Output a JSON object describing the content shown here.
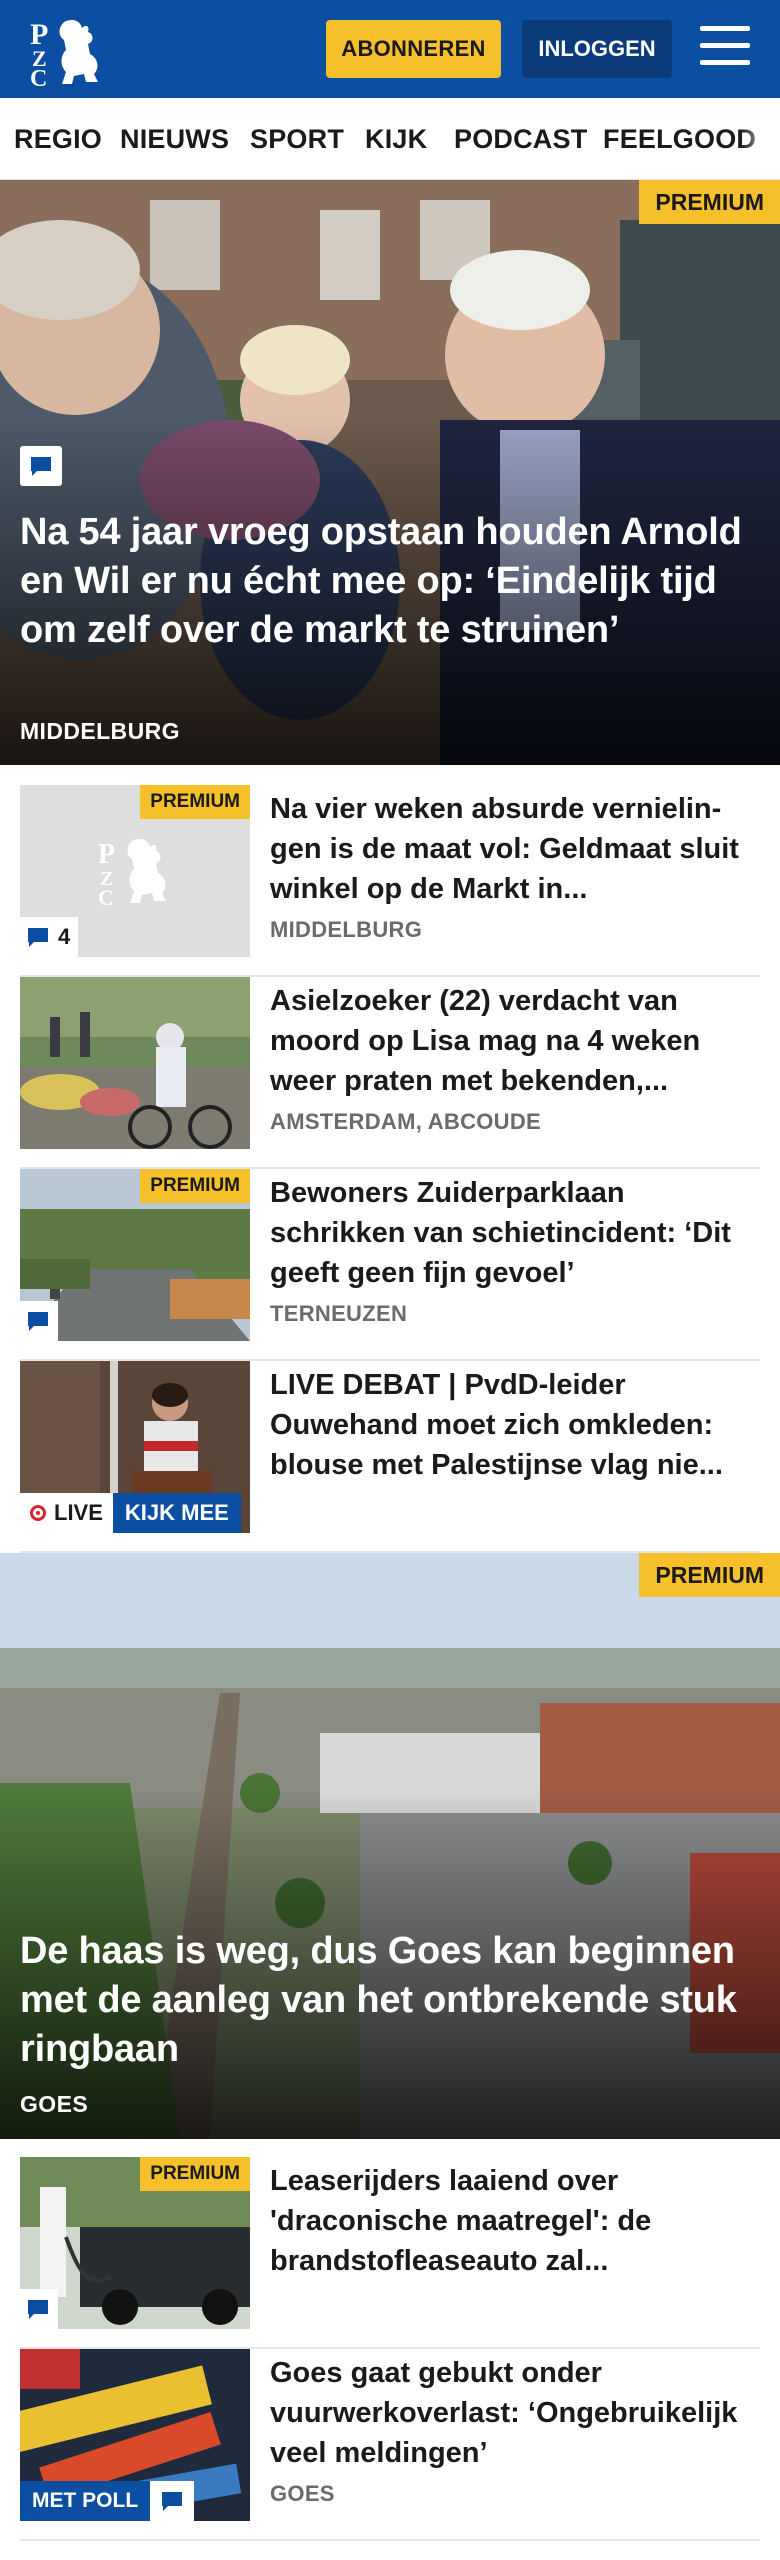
{
  "header": {
    "logo_text": "PZC",
    "subscribe_label": "ABONNEREN",
    "login_label": "INLOGGEN"
  },
  "nav": {
    "items": [
      "REGIO",
      "NIEUWS",
      "SPORT",
      "KIJK",
      "PODCAST",
      "FEELGOOD"
    ]
  },
  "colors": {
    "brand_blue": "#0b4ea2",
    "premium_yellow": "#f5c02a",
    "live_red": "#d9232e"
  },
  "hero1": {
    "badge": "PREMIUM",
    "title": "Na 54 jaar vroeg opstaan houden Arnold en Wil er nu écht mee op: ‘Eindelijk tijd om zelf over de markt te struinen’",
    "location": "MIDDELBURG",
    "icon": "comment-icon"
  },
  "articles": [
    {
      "badge": "PREMIUM",
      "title": "Na vier weken absurde vernielin­gen is de maat vol: Geldmaat sluit winkel op de Markt in...",
      "location": "MIDDELBURG",
      "comment_count": "4"
    },
    {
      "title": "Asielzoeker (22) verdacht van moord op Lisa mag na 4 weken weer praten met bekenden,...",
      "location": "AMSTERDAM, ABCOUDE"
    },
    {
      "badge": "PREMIUM",
      "title": "Bewoners Zuiderparklaan schrikken van schietincident: ‘Dit geeft geen fijn gevoel’",
      "location": "TERNEUZEN"
    },
    {
      "title": "LIVE DEBAT | PvdD-leider Ouwehand moet zich omkleden: blouse met Palestijnse vlag nie...",
      "live_label": "LIVE",
      "watch_label": "KIJK MEE"
    }
  ],
  "hero2": {
    "badge": "PREMIUM",
    "title": "De haas is weg, dus Goes kan beginnen met de aanleg van het ontbrekende stuk ringbaan",
    "location": "GOES"
  },
  "articles2": [
    {
      "badge": "PREMIUM",
      "title": "Leaserijders laaiend over 'draconische maatregel': de brandstofleaseauto zal..."
    },
    {
      "title": "Goes gaat gebukt onder vuurwerkoverlast: ‘Ongebruike­lijk veel meldingen’",
      "location": "GOES",
      "poll_label": "MET POLL"
    }
  ]
}
